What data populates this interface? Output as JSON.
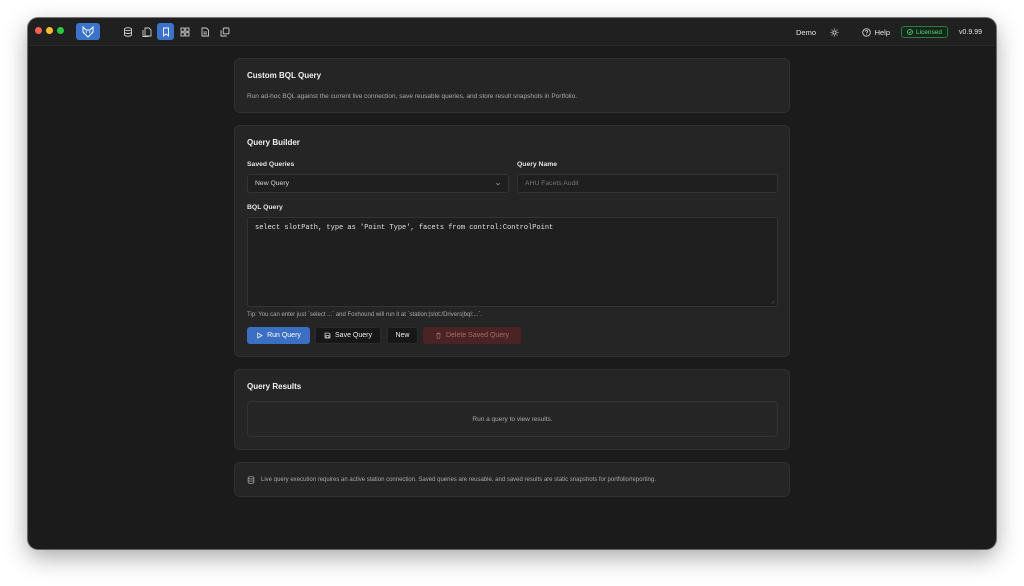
{
  "titlebar": {
    "demo_label": "Demo",
    "help_label": "Help",
    "licensed_label": "Licensed",
    "version": "v0.9.99"
  },
  "intro": {
    "title": "Custom BQL Query",
    "description": "Run ad-hoc BQL against the current live connection, save reusable queries, and store result snapshots in Portfolio."
  },
  "builder": {
    "title": "Query Builder",
    "saved_queries_label": "Saved Queries",
    "saved_queries_value": "New Query",
    "query_name_label": "Query Name",
    "query_name_placeholder": "AHU Facets Audit",
    "bql_label": "BQL Query",
    "bql_value": "select slotPath, type as 'Point Type', facets from control:ControlPoint",
    "tip": "Tip: You can enter just `select ...` and Foxhound will run it at `station:|slot:/Drivers|bql:...`.",
    "buttons": {
      "run": "Run Query",
      "save": "Save Query",
      "new": "New",
      "delete": "Delete Saved Query"
    }
  },
  "results": {
    "title": "Query Results",
    "empty_text": "Run a query to view results."
  },
  "footer_note": {
    "text": "Live query execution requires an active station connection. Saved queries are reusable, and saved results are static snapshots for portfolio/reporting."
  },
  "colors": {
    "accent": "#3a73c9",
    "licensed": "#5fd27a",
    "danger": "#4a2324",
    "background": "#1b1b1c",
    "card": "#252526"
  }
}
